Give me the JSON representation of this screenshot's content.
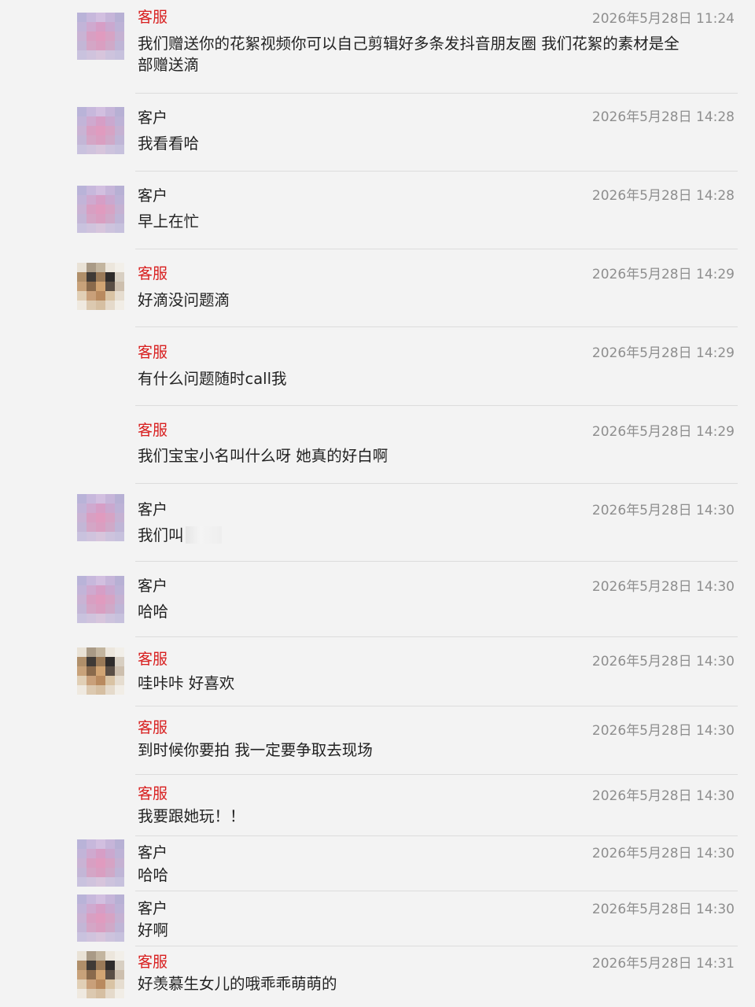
{
  "labels": {
    "agent": "客服",
    "customer": "客户"
  },
  "colors": {
    "agent_name": "#d81e1e",
    "customer_name": "#222222",
    "timestamp": "#8e8e8e",
    "background": "#f3f3f3",
    "separator": "#dcdcdc"
  },
  "messages": [
    {
      "sender": "客服",
      "role": "agent",
      "avatar": "avatar-agent-dog-pixelated",
      "time": "2026年5月28日 11:24",
      "text": "我们赠送你的花絮视频你可以自己剪辑好多条发抖音朋友圈 我们花絮的素材是全部赠送滴"
    },
    {
      "sender": "客户",
      "role": "customer",
      "avatar": "avatar-customer-pink-pixelated",
      "time": "2026年5月28日 14:28",
      "text": "我看看哈"
    },
    {
      "sender": "客户",
      "role": "customer",
      "avatar": "avatar-customer-pink-pixelated",
      "time": "2026年5月28日 14:28",
      "text": "早上在忙"
    },
    {
      "sender": "客服",
      "role": "agent",
      "avatar": "avatar-agent-dog-pixelated",
      "time": "2026年5月28日 14:29",
      "text": "好滴没问题滴"
    },
    {
      "sender": "客服",
      "role": "agent",
      "avatar": "",
      "time": "2026年5月28日 14:29",
      "text": "有什么问题随时call我"
    },
    {
      "sender": "客服",
      "role": "agent",
      "avatar": "",
      "time": "2026年5月28日 14:29",
      "text": "我们宝宝小名叫什么呀 她真的好白啊"
    },
    {
      "sender": "客户",
      "role": "customer",
      "avatar": "avatar-customer-pink-pixelated",
      "time": "2026年5月28日 14:30",
      "text": "我们叫",
      "redacted": true
    },
    {
      "sender": "客户",
      "role": "customer",
      "avatar": "avatar-customer-pink-pixelated",
      "time": "2026年5月28日 14:30",
      "text": "哈哈"
    },
    {
      "sender": "客服",
      "role": "agent",
      "avatar": "avatar-agent-dog-pixelated",
      "time": "2026年5月28日 14:30",
      "text": "哇咔咔 好喜欢"
    },
    {
      "sender": "客服",
      "role": "agent",
      "avatar": "",
      "time": "2026年5月28日 14:30",
      "text": "到时候你要拍 我一定要争取去现场"
    },
    {
      "sender": "客服",
      "role": "agent",
      "avatar": "",
      "time": "2026年5月28日 14:30",
      "text": "我要跟她玩！！"
    },
    {
      "sender": "客户",
      "role": "customer",
      "avatar": "avatar-customer-pink-pixelated",
      "time": "2026年5月28日 14:30",
      "text": "哈哈"
    },
    {
      "sender": "客户",
      "role": "customer",
      "avatar": "avatar-customer-pink-pixelated",
      "time": "2026年5月28日 14:30",
      "text": "好啊"
    },
    {
      "sender": "客服",
      "role": "agent",
      "avatar": "avatar-agent-dog-pixelated",
      "time": "2026年5月28日 14:31",
      "text": "好羡慕生女儿的哦乖乖萌萌的"
    }
  ]
}
